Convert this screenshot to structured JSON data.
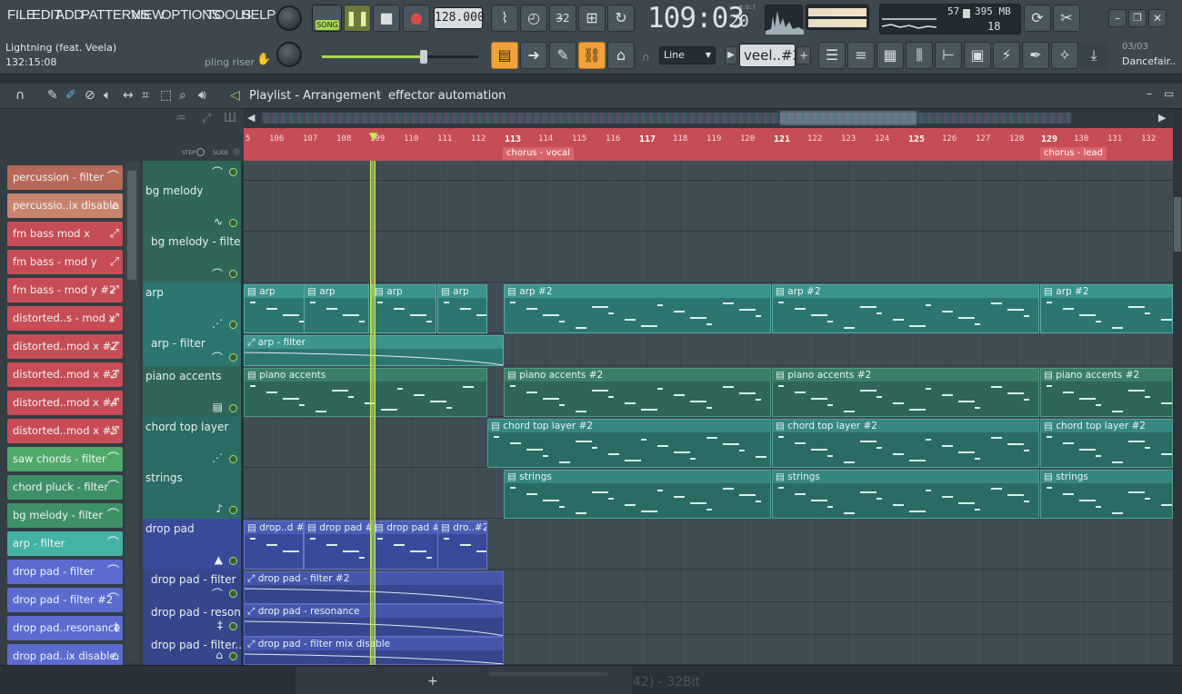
{
  "menu": [
    "FILE",
    "EDIT",
    "ADD",
    "PATTERNS",
    "VIEW",
    "OPTIONS",
    "TOOLS",
    "HELP"
  ],
  "transport": {
    "mode": "SONG",
    "tempo": "128.000",
    "time_main": "109:03",
    "time_sub": "20",
    "time_unit": "B:S:T"
  },
  "song_info": {
    "title": "Lightning (feat. Veela)",
    "time": "132:15:08",
    "hint": "pling riser"
  },
  "monitor": {
    "cpu": "57",
    "memory": "395 MB",
    "polyphony": "18"
  },
  "snap": {
    "label": "Line"
  },
  "pattern": {
    "label": "veel..#2"
  },
  "project": {
    "page": "03/03",
    "name": "Dancefair..."
  },
  "playlist": {
    "title": "Playlist - Arrangement",
    "separator": "›",
    "current": "effector automation",
    "step_label": "STEP",
    "slide_label": "SLIDE"
  },
  "timeline": {
    "bars": [
      "5",
      "106",
      "107",
      "108",
      "109",
      "110",
      "111",
      "112",
      "113",
      "114",
      "115",
      "116",
      "117",
      "118",
      "119",
      "120",
      "121",
      "122",
      "123",
      "124",
      "125",
      "126",
      "127",
      "128",
      "129",
      "130",
      "131",
      "132"
    ],
    "markers": [
      {
        "label": "chorus - vocal",
        "bar": "113"
      },
      {
        "label": "chorus - lead",
        "bar": "129"
      }
    ]
  },
  "picker": [
    {
      "label": "percussion - filter",
      "color": "#b86a58",
      "icon": "⌒"
    },
    {
      "label": "percussio..ix disable",
      "color": "#c9846e",
      "icon": "⌂"
    },
    {
      "label": "fm bass mod x",
      "color": "#c74c56",
      "icon": "⤢"
    },
    {
      "label": "fm bass - mod y",
      "color": "#c74c56",
      "icon": "⤢"
    },
    {
      "label": "fm bass - mod y #2",
      "color": "#c74c56",
      "icon": "⤢"
    },
    {
      "label": "distorted..s - mod x",
      "color": "#c74c56",
      "icon": "⤢"
    },
    {
      "label": "distorted..mod x #2",
      "color": "#c74c56",
      "icon": "⤢"
    },
    {
      "label": "distorted..mod x #3",
      "color": "#c74c56",
      "icon": "⤢"
    },
    {
      "label": "distorted..mod x #4",
      "color": "#c74c56",
      "icon": "⤢"
    },
    {
      "label": "distorted..mod x #5",
      "color": "#c74c56",
      "icon": "⤢"
    },
    {
      "label": "saw chords - filter",
      "color": "#4faa6a",
      "icon": "⌒"
    },
    {
      "label": "chord pluck - filter",
      "color": "#3e9166",
      "icon": "⌒"
    },
    {
      "label": "bg melody - filter",
      "color": "#3e9166",
      "icon": "⌒"
    },
    {
      "label": "arp - filter",
      "color": "#43b3a3",
      "icon": "⌒"
    },
    {
      "label": "drop pad - filter",
      "color": "#5b6bd0",
      "icon": "⌒"
    },
    {
      "label": "drop pad - filter #2",
      "color": "#5b6bd0",
      "icon": "⌒"
    },
    {
      "label": "drop pad..resonance",
      "color": "#5b6bd0",
      "icon": "‡"
    },
    {
      "label": "drop pad..ix disable",
      "color": "#5b6bd0",
      "icon": "⌂"
    }
  ],
  "tracks": [
    {
      "name": "",
      "color": "#2f6657"
    },
    {
      "name": "bg melody",
      "color": "#2f6657"
    },
    {
      "name": "bg melody - filter",
      "color": "#2f6657"
    },
    {
      "name": "arp",
      "color": "#2c7670"
    },
    {
      "name": "arp - filter",
      "color": "#2c7670"
    },
    {
      "name": "piano accents",
      "color": "#2f6657"
    },
    {
      "name": "chord top layer",
      "color": "#2a6b63"
    },
    {
      "name": "strings",
      "color": "#2a6b63"
    },
    {
      "name": "drop pad",
      "color": "#3a4a9a"
    },
    {
      "name": "drop pad - filter",
      "color": "#37458c"
    },
    {
      "name": "drop pad - resona...",
      "color": "#37458c"
    },
    {
      "name": "drop pad - filter...",
      "color": "#37458c"
    }
  ],
  "clips": {
    "arp": [
      "arp",
      "arp",
      "arp",
      "arp",
      "arp #2",
      "arp #2",
      "arp #2"
    ],
    "arp_filter": [
      "arp - filter"
    ],
    "piano": [
      "piano accents",
      "piano accents #2",
      "piano accents #2",
      "piano accents #2"
    ],
    "chord": [
      "chord top layer #2",
      "chord top layer #2",
      "chord top layer #2"
    ],
    "strings": [
      "strings",
      "strings",
      "strings"
    ],
    "droppad": [
      "drop..d #2",
      "drop pad #2",
      "drop pad #2",
      "dro..#2"
    ],
    "dp_filter": [
      "drop pad - filter #2"
    ],
    "dp_res": [
      "drop pad - resonance"
    ],
    "dp_mix": [
      "drop pad - filter mix disable"
    ]
  },
  "status": {
    "text": "42) - 32Bit"
  }
}
